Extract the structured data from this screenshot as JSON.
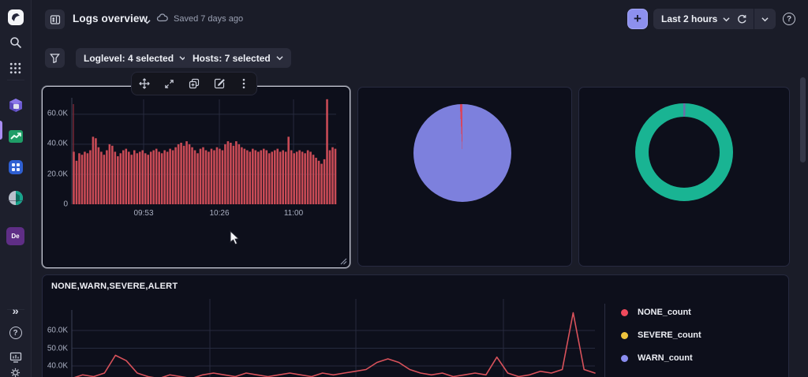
{
  "header": {
    "title": "Logs overview",
    "saved_status": "Saved 7 days ago",
    "time_range": "Last 2 hours",
    "add_label": "+"
  },
  "filters": {
    "loglevel": "Loglevel: 4 selected",
    "hosts": "Hosts: 7 selected"
  },
  "sidebar": {
    "de_app_label": "De",
    "expand_glyph": "»",
    "help_glyph": "?"
  },
  "icons": {
    "help_glyph": "?"
  },
  "colors": {
    "accent": "#8d90ee",
    "bar_red": "#c94b56",
    "line_red": "#d9525b",
    "pie_purple": "#7d80dd",
    "pie_sliver_red": "#d6455f",
    "donut_teal": "#19b493",
    "donut_sliver": "#6b6ea8",
    "legend_red": "#ef4a5c",
    "legend_yellow": "#eec33d",
    "legend_purple": "#8a8df0"
  },
  "chart_data": [
    {
      "type": "bar",
      "title": "",
      "color": "#c94b56",
      "ylim_k": [
        0,
        72
      ],
      "yticks": [
        "0",
        "20.0K",
        "40.0K",
        "60.0K"
      ],
      "ytick_values_k": [
        0,
        20,
        40,
        60
      ],
      "xticks": [
        "09:53",
        "10:26",
        "11:00"
      ],
      "values_k": [
        35,
        29,
        34,
        33,
        35,
        34,
        36,
        45,
        44,
        38,
        35,
        33,
        36,
        40,
        39,
        35,
        32,
        34,
        36,
        37,
        35,
        33,
        36,
        34,
        35,
        36,
        34,
        33,
        35,
        36,
        37,
        35,
        34,
        36,
        35,
        37,
        36,
        38,
        40,
        41,
        39,
        42,
        40,
        38,
        36,
        34,
        37,
        38,
        36,
        35,
        37,
        36,
        38,
        37,
        36,
        40,
        42,
        41,
        39,
        42,
        40,
        38,
        37,
        36,
        35,
        37,
        36,
        35,
        36,
        37,
        36,
        34,
        35,
        36,
        37,
        35,
        36,
        35,
        45,
        36,
        34,
        35,
        36,
        35,
        34,
        36,
        35,
        33,
        31,
        29,
        27,
        30,
        70,
        36,
        38,
        37
      ]
    },
    {
      "type": "pie",
      "start_deg": -3,
      "segments": [
        {
          "pct": 0.8,
          "color": "#d6455f"
        },
        {
          "pct": 99.2,
          "color": "#7d80dd"
        }
      ]
    },
    {
      "type": "pie",
      "variant": "donut",
      "start_deg": -1,
      "inner_ratio": 0.72,
      "segments": [
        {
          "pct": 0.7,
          "color": "#6b6ea8"
        },
        {
          "pct": 99.3,
          "color": "#19b493"
        }
      ]
    },
    {
      "type": "line",
      "title": "NONE,WARN,SEVERE,ALERT",
      "yticks": [
        "40.0K",
        "50.0K",
        "60.0K"
      ],
      "ytick_values_k": [
        40,
        50,
        60
      ],
      "legend": [
        {
          "label": "NONE_count",
          "color": "#ef4a5c"
        },
        {
          "label": "SEVERE_count",
          "color": "#eec33d"
        },
        {
          "label": "WARN_count",
          "color": "#8a8df0"
        }
      ],
      "series": [
        {
          "name": "NONE_count",
          "color": "#d9525b",
          "values_k": [
            33,
            35,
            34,
            36,
            46,
            43,
            36,
            34,
            33,
            35,
            34,
            33,
            35,
            36,
            35,
            34,
            36,
            35,
            34,
            35,
            36,
            35,
            34,
            36,
            35,
            36,
            37,
            38,
            42,
            44,
            42,
            38,
            36,
            35,
            36,
            34,
            35,
            36,
            35,
            45,
            36,
            34,
            35,
            37,
            36,
            38,
            70,
            38,
            36
          ]
        }
      ]
    }
  ]
}
